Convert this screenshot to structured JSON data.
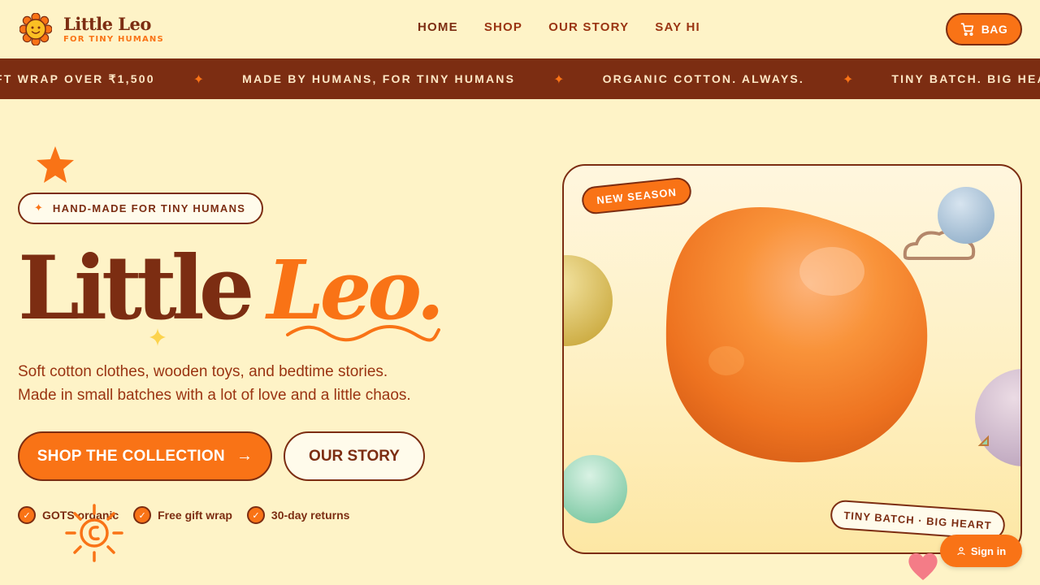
{
  "brand": {
    "name": "Little Leo",
    "tagline": "FOR TINY HUMANS"
  },
  "nav": {
    "items": [
      {
        "label": "HOME",
        "active": true
      },
      {
        "label": "SHOP",
        "active": false
      },
      {
        "label": "OUR STORY",
        "active": false
      },
      {
        "label": "SAY HI",
        "active": false
      }
    ]
  },
  "bag": {
    "label": "BAG"
  },
  "marquee": {
    "items": [
      "FT WRAP OVER ₹1,500",
      "MADE BY HUMANS, FOR TINY HUMANS",
      "ORGANIC COTTON. ALWAYS.",
      "TINY BATCH. BIG HEART."
    ],
    "separator": "✦"
  },
  "hero": {
    "pill_icon": "✦",
    "pill": "HAND-MADE FOR TINY HUMANS",
    "title_part1": "Little",
    "title_part2": "Leo.",
    "subtitle_line1": "Soft cotton clothes, wooden toys, and bedtime stories.",
    "subtitle_line2": "Made in small batches with a lot of love and a little chaos.",
    "primary_cta": "SHOP THE COLLECTION",
    "primary_arrow": "→",
    "secondary_cta": "OUR STORY",
    "features": [
      "GOTS organic",
      "Free gift wrap",
      "30-day returns"
    ]
  },
  "card": {
    "badge_new": "NEW SEASON",
    "badge_bottom": "TINY BATCH · BIG HEART"
  },
  "signin": {
    "label": "Sign in"
  },
  "colors": {
    "background": "#fef3c7",
    "brown": "#7c2d12",
    "orange": "#f97316"
  }
}
